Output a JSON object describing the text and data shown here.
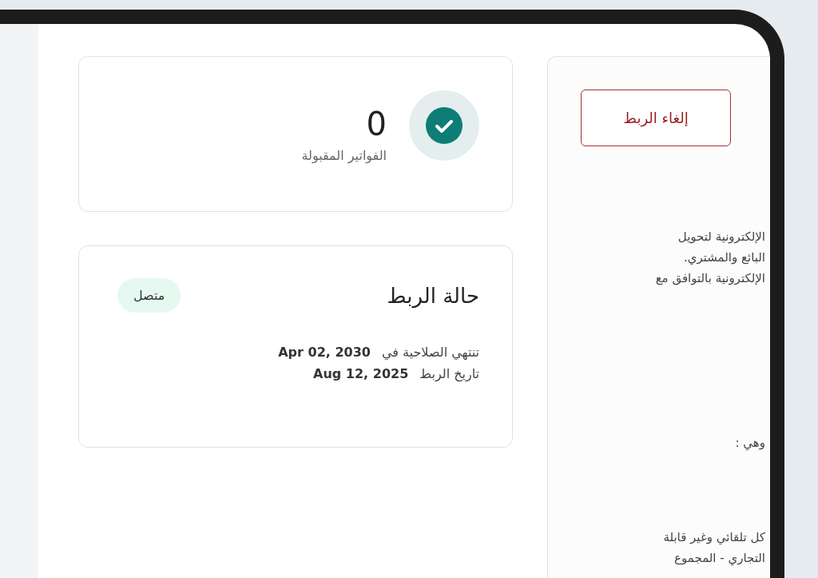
{
  "accepted_invoices": {
    "count": "0",
    "label": "الفواتير المقبولة"
  },
  "connection_status": {
    "title": "حالة الربط",
    "status": {
      "label": "متصل",
      "connected": true
    },
    "details": [
      {
        "label": "تنتهي الصلاحية في",
        "value": "Apr 02, 2030"
      },
      {
        "label": "تاريخ الربط",
        "value": "Aug 12, 2025"
      }
    ]
  },
  "side_panel": {
    "unlink_button": "إلغاء الربط",
    "text_blocks": [
      [
        "الإلكترونية لتحويل",
        "البائع والمشتري.",
        "الإلكترونية بالتوافق مع"
      ],
      [
        "وهي :"
      ],
      [
        "كل تلقائي وغير قابلة",
        "التجاري - المجموع"
      ]
    ]
  }
}
